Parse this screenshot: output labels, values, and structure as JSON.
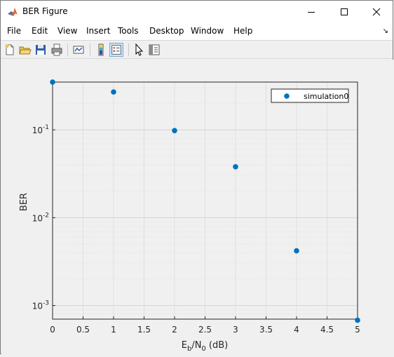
{
  "window": {
    "title": "BER Figure",
    "app_icon": "matlab-icon"
  },
  "menu": [
    "File",
    "Edit",
    "View",
    "Insert",
    "Tools",
    "Desktop",
    "Window",
    "Help"
  ],
  "toolbar": {
    "icons": [
      "new-figure-icon",
      "open-file-icon",
      "save-icon",
      "print-icon",
      "link-plot-icon",
      "insert-colorbar-icon",
      "insert-legend-icon",
      "edit-plot-icon",
      "property-inspector-icon"
    ]
  },
  "chart_data": {
    "type": "scatter",
    "x": [
      0,
      1,
      2,
      3,
      4,
      5
    ],
    "series": [
      {
        "name": "simulation0",
        "values": [
          0.35,
          0.27,
          0.098,
          0.038,
          0.0042,
          0.00068
        ],
        "color": "#0072bd"
      }
    ],
    "xlabel": {
      "main": "E",
      "sub1": "b",
      "mid": "/N",
      "sub2": "0",
      "tail": " (dB)"
    },
    "ylabel": "BER",
    "xlim": [
      0,
      5
    ],
    "ylim": [
      0.0007,
      0.35
    ],
    "yscale": "log",
    "xticks": [
      "0",
      "0.5",
      "1",
      "1.5",
      "2",
      "2.5",
      "3",
      "3.5",
      "4",
      "4.5",
      "5"
    ],
    "yticks": [
      {
        "value": 0.1,
        "base": "10",
        "exp": "-1"
      },
      {
        "value": 0.01,
        "base": "10",
        "exp": "-2"
      },
      {
        "value": 0.001,
        "base": "10",
        "exp": "-3"
      }
    ],
    "grid": true,
    "minor_grid": true,
    "legend": "top-right"
  }
}
